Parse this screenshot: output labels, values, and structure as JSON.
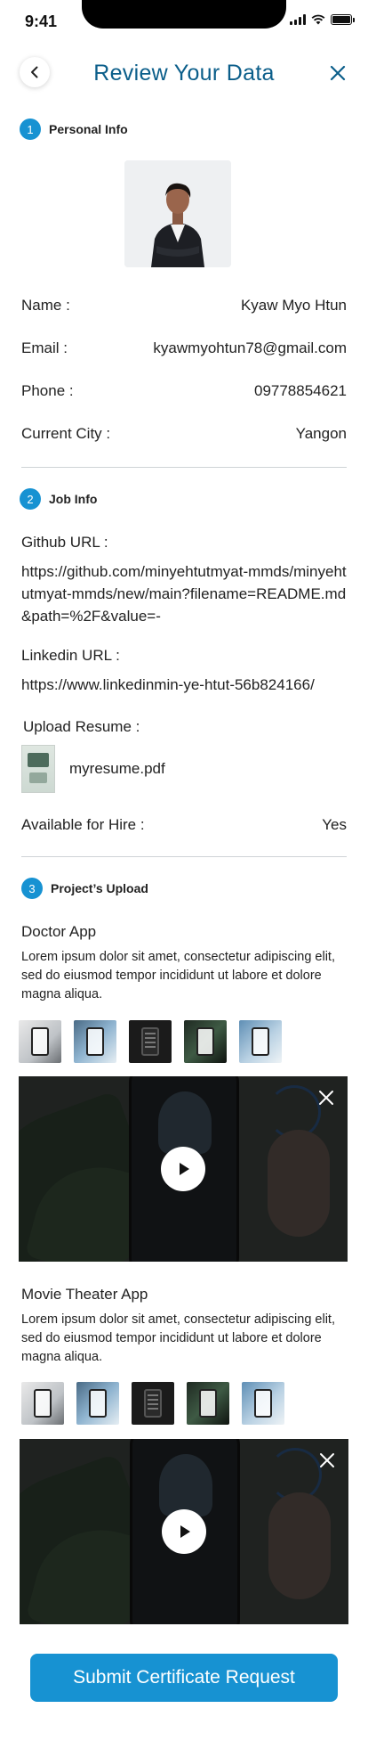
{
  "status_bar": {
    "time": "9:41"
  },
  "header": {
    "title": "Review Your Data"
  },
  "sections": {
    "personal": {
      "number": "1",
      "label": "Personal Info"
    },
    "job": {
      "number": "2",
      "label": "Job Info"
    },
    "projects": {
      "number": "3",
      "label": "Project’s Upload"
    }
  },
  "personal": {
    "name_label": "Name :",
    "name_value": "Kyaw Myo Htun",
    "email_label": "Email :",
    "email_value": "kyawmyohtun78@gmail.com",
    "phone_label": "Phone :",
    "phone_value": "09778854621",
    "city_label": "Current City :",
    "city_value": "Yangon"
  },
  "job": {
    "github_label": "Github URL :",
    "github_value": "https://github.com/minyehtutmyat-mmds/minyehtutmyat-mmds/new/main?filename=README.md&path=%2F&value=-",
    "linkedin_label": "Linkedin URL :",
    "linkedin_value": "https://www.linkedinmin-ye-htut-56b824166/",
    "resume_label": "Upload Resume :",
    "resume_file": "myresume.pdf",
    "hire_label": "Available for Hire :",
    "hire_value": "Yes"
  },
  "projects": [
    {
      "title": "Doctor App",
      "description": "Lorem ipsum dolor sit amet, consectetur adipiscing elit, sed do eiusmod tempor incididunt ut labore et dolore magna aliqua."
    },
    {
      "title": "Movie Theater App",
      "description": "Lorem ipsum dolor sit amet, consectetur adipiscing elit, sed do eiusmod tempor incididunt ut labore et dolore magna aliqua."
    }
  ],
  "submit": {
    "label": "Submit Certificate Request"
  },
  "colors": {
    "accent": "#1792d2",
    "title": "#0b5e8a"
  },
  "icons": [
    "back-arrow-icon",
    "close-icon",
    "play-icon",
    "signal-icon",
    "wifi-icon",
    "battery-icon"
  ]
}
